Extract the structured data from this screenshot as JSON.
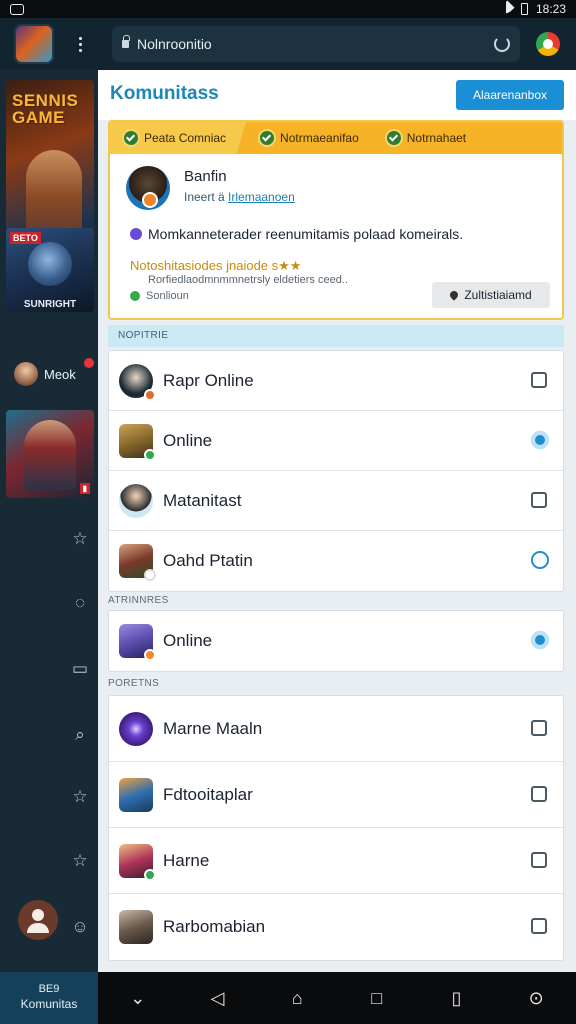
{
  "status_bar": {
    "time": "18:23"
  },
  "browser": {
    "url": "Nolnroonitio"
  },
  "sidebar": {
    "promo1_title": "SENNIS GAME",
    "promo2_tag": "BETO",
    "promo2_caption": "SUNRIGHT",
    "user_name": "Meok",
    "bottom_tab": {
      "line1": "BE9",
      "line2": "Komunitas"
    }
  },
  "header": {
    "title": "Komunitass",
    "cta_label": "Alaarenanbox"
  },
  "feature_card": {
    "tabs": [
      "Peata Comniac",
      "Notrmaeanifao",
      "Notrnahaet"
    ],
    "name": "Banfin",
    "meta_prefix": "Ineert ä",
    "meta_link": "Irlemaanoen",
    "description": "Momkanneterader reenumitamis polaad komeirals.",
    "stars_line": "Notoshitasiodes jnaiode s★★",
    "small_text": "Rorfiedlaodmnmmnetrsly eldetiers ceed..",
    "status_text": "Sonlioun",
    "action_label": "Zultistiaiamd"
  },
  "sections": [
    {
      "header": "NOPITRIE",
      "items": [
        {
          "label": "Rapr Online",
          "control": "checkbox",
          "avatar_color": "#1c2b33",
          "badge": "#e66b2a"
        },
        {
          "label": "Online",
          "control": "radio-on",
          "avatar_color": "#8a6a2a",
          "badge": "#2fa84f"
        },
        {
          "label": "Matanitast",
          "control": "checkbox",
          "avatar_color": "#cde7f5",
          "badge": ""
        },
        {
          "label": "Oahd Ptatin",
          "control": "radio-off",
          "avatar_color": "#7b3a2a",
          "badge": "#ffffff"
        }
      ]
    },
    {
      "header": "ATRINNRES",
      "items": [
        {
          "label": "Online",
          "control": "radio-on",
          "avatar_color": "#5a4fae",
          "badge": "#f08a2a"
        }
      ]
    },
    {
      "header": "PORETNS",
      "items": [
        {
          "label": "Marne Maaln",
          "control": "checkbox",
          "avatar_color": "#3a1f7a",
          "badge": ""
        },
        {
          "label": "Fdtooitaplar",
          "control": "checkbox",
          "avatar_color": "#2e6fb0",
          "badge": ""
        },
        {
          "label": "Harne",
          "control": "checkbox",
          "avatar_color": "#b0365a",
          "badge": "#2fa84f"
        },
        {
          "label": "Rarbomabian",
          "control": "checkbox",
          "avatar_color": "#6a5a4a",
          "badge": ""
        }
      ]
    }
  ]
}
